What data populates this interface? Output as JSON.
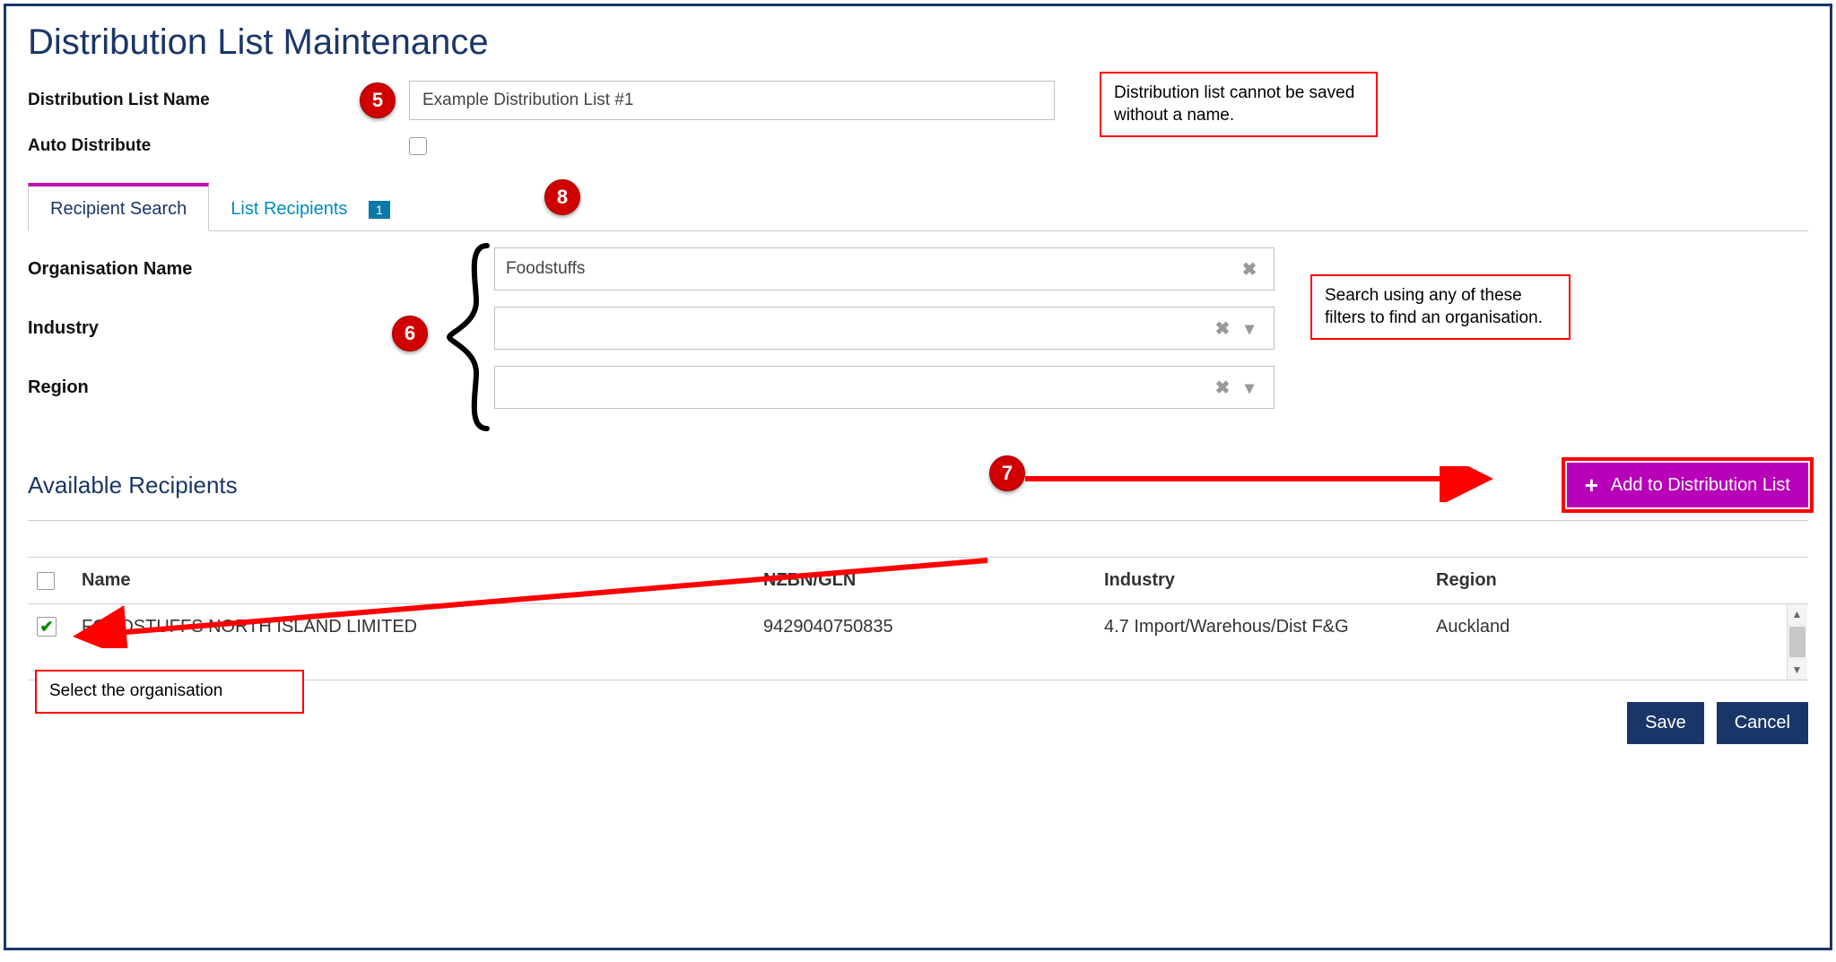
{
  "page": {
    "title": "Distribution List Maintenance"
  },
  "form": {
    "dist_name_label": "Distribution List Name",
    "dist_name_value": "Example Distribution List #1",
    "auto_distribute_label": "Auto Distribute"
  },
  "tabs": {
    "recipient_search": "Recipient Search",
    "list_recipients": "List Recipients",
    "list_recipients_count": "1"
  },
  "filters": {
    "org_label": "Organisation Name",
    "org_value": "Foodstuffs",
    "industry_label": "Industry",
    "industry_value": "",
    "region_label": "Region",
    "region_value": ""
  },
  "available": {
    "title": "Available Recipients",
    "add_button": "Add to Distribution List",
    "columns": {
      "name": "Name",
      "nzbn": "NZBN/GLN",
      "industry": "Industry",
      "region": "Region"
    },
    "rows": [
      {
        "checked": true,
        "name": "FOODSTUFFS NORTH ISLAND LIMITED",
        "nzbn": "9429040750835",
        "industry": "4.7 Import/Warehous/Dist F&G",
        "region": "Auckland"
      }
    ]
  },
  "actions": {
    "save": "Save",
    "cancel": "Cancel"
  },
  "annotations": {
    "badge5": "5",
    "badge6": "6",
    "badge7": "7",
    "badge8": "8",
    "note_name": "Distribution list cannot be saved without a name.",
    "note_filters": "Search using any of these filters to find an organisation.",
    "note_select": "Select the organisation"
  }
}
